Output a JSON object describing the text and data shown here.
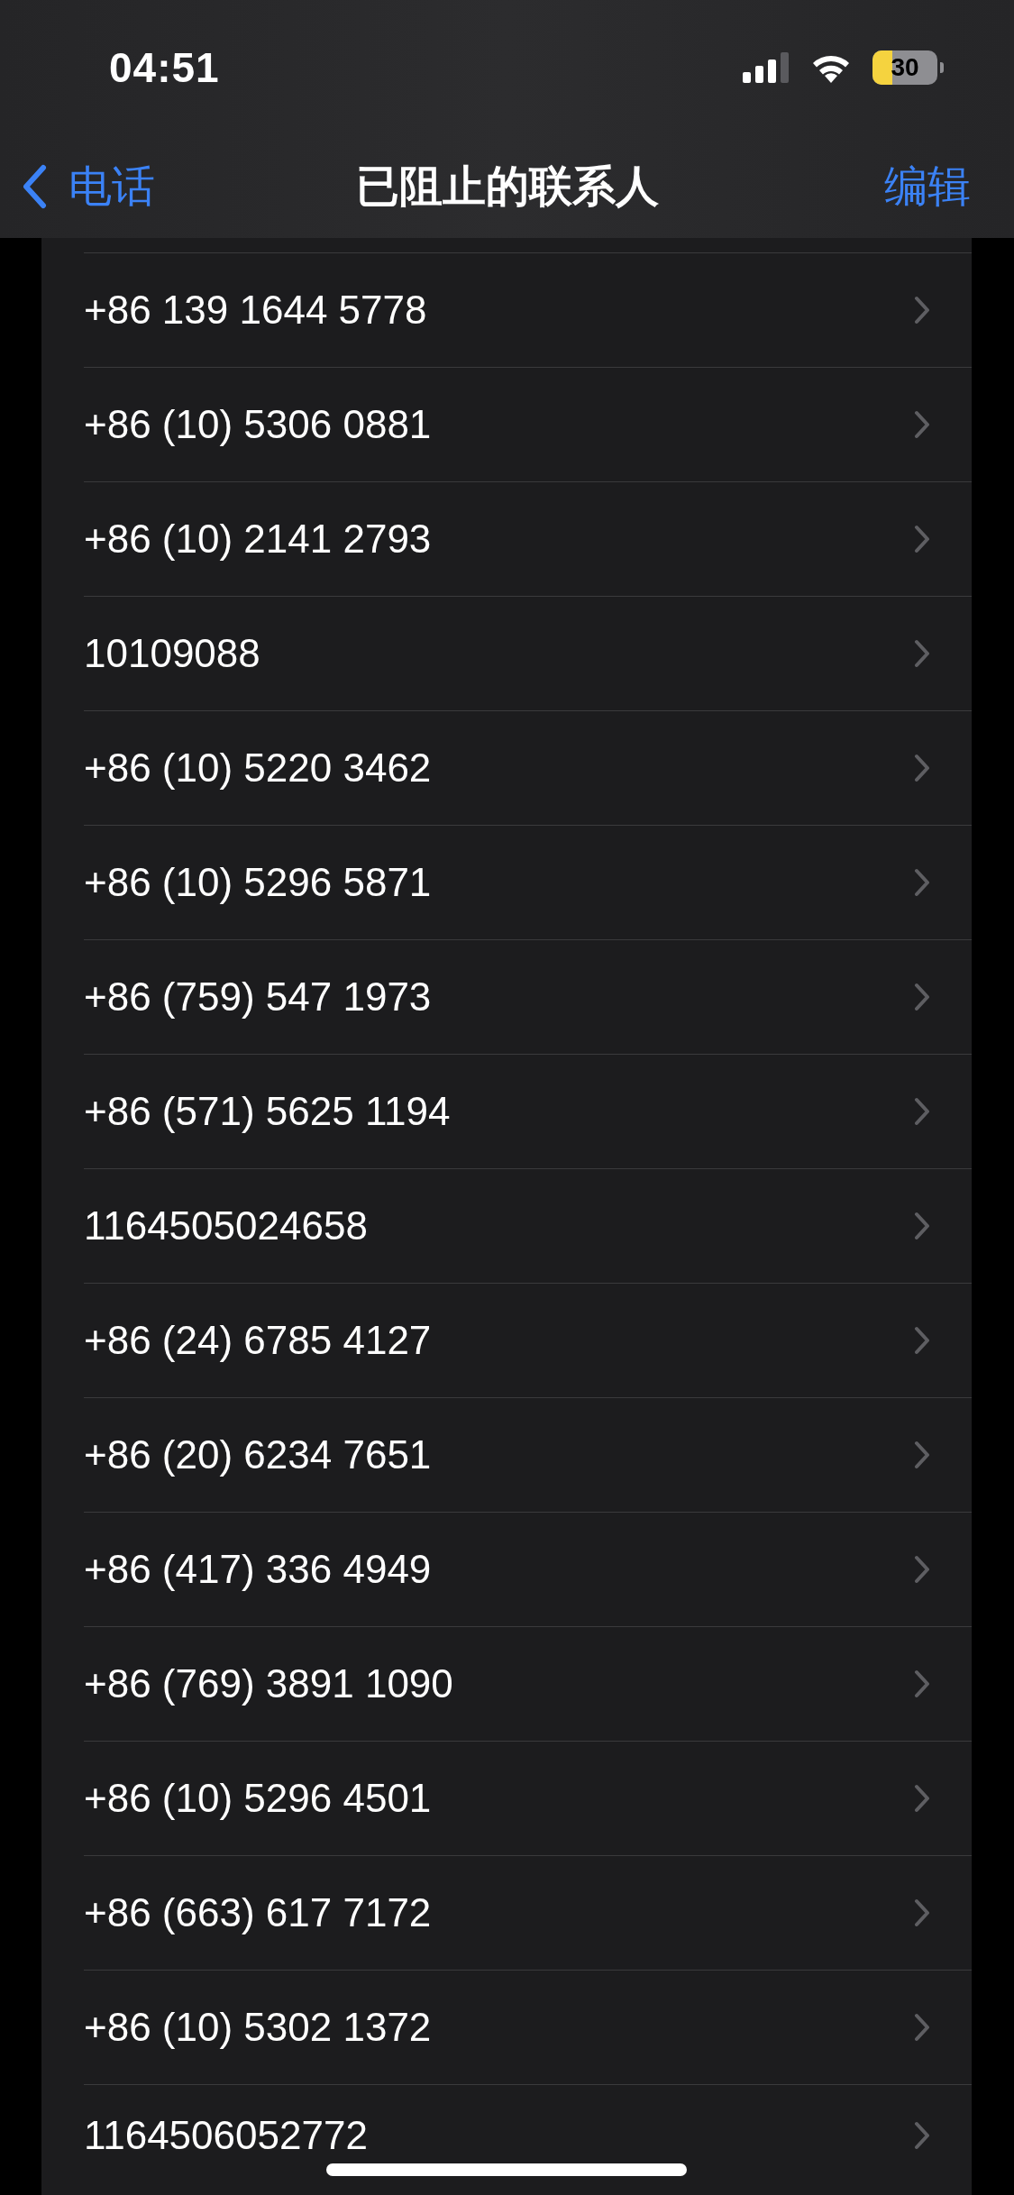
{
  "status_bar": {
    "time": "04:51",
    "battery": "30"
  },
  "nav_bar": {
    "back": "电话",
    "title": "已阻止的联系人",
    "action": "编辑"
  },
  "contacts": [
    {
      "number": "+86 139 1644 5778"
    },
    {
      "number": "+86 (10) 5306 0881"
    },
    {
      "number": "+86 (10) 2141 2793"
    },
    {
      "number": "10109088"
    },
    {
      "number": "+86 (10) 5220 3462"
    },
    {
      "number": "+86 (10) 5296 5871"
    },
    {
      "number": "+86 (759) 547 1973"
    },
    {
      "number": "+86 (571) 5625 1194"
    },
    {
      "number": "1164505024658"
    },
    {
      "number": "+86 (24) 6785 4127"
    },
    {
      "number": "+86 (20) 6234 7651"
    },
    {
      "number": "+86 (417) 336 4949"
    },
    {
      "number": "+86 (769) 3891 1090"
    },
    {
      "number": "+86 (10) 5296 4501"
    },
    {
      "number": "+86 (663) 617 7172"
    },
    {
      "number": "+86 (10) 5302 1372"
    },
    {
      "number": "1164506052772"
    }
  ]
}
